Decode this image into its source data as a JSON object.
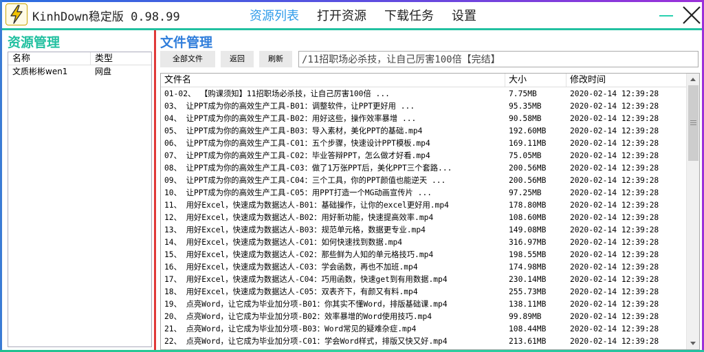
{
  "app": {
    "title": "KinhDown稳定版 0.98.99",
    "logo_icon": "lightning-bolt-icon",
    "accent_color": "#2f9bea",
    "teal_color": "#22c0a0",
    "divider_color": "#e03838"
  },
  "nav": {
    "items": [
      {
        "label": "资源列表",
        "active": true
      },
      {
        "label": "打开资源",
        "active": false
      },
      {
        "label": "下载任务",
        "active": false
      },
      {
        "label": "设置",
        "active": false
      }
    ]
  },
  "window_controls": {
    "minimize_icon": "minimize-icon",
    "close_icon": "close-icon"
  },
  "resource_panel": {
    "title": "资源管理",
    "columns": [
      "名称",
      "类型"
    ],
    "rows": [
      {
        "name": "文质彬彬wen1",
        "type": "网盘"
      }
    ]
  },
  "file_panel": {
    "title": "文件管理",
    "toolbar": {
      "all_files": "全部文件",
      "back": "返回",
      "refresh": "刷新"
    },
    "path": "/11招职场必杀技，让自己厉害100倍【完结】",
    "columns": [
      "文件名",
      "大小",
      "修改时间"
    ],
    "rows": [
      {
        "name": "01-02、 【购课须知】11招职场必杀技，让自己厉害100倍                    ...",
        "size": "7.75MB",
        "time": "2020-02-14 12:39:28"
      },
      {
        "name": "03、  让PPT成为你的高效生产工具-B01：调整软件，让PPT更好用                ...",
        "size": "95.35MB",
        "time": "2020-02-14 12:39:28"
      },
      {
        "name": "04、  让PPT成为你的高效生产工具-B02：用好这些，操作效率暴增                ...",
        "size": "90.58MB",
        "time": "2020-02-14 12:39:28"
      },
      {
        "name": "05、  让PPT成为你的高效生产工具-B03：导入素材，美化PPT的基础.mp4",
        "size": "192.60MB",
        "time": "2020-02-14 12:39:28"
      },
      {
        "name": "06、  让PPT成为你的高效生产工具-C01：五个步骤，快速设计PPT模板.mp4",
        "size": "169.11MB",
        "time": "2020-02-14 12:39:28"
      },
      {
        "name": "07、  让PPT成为你的高效生产工具-C02：毕业答辩PPT，怎么做才好看.mp4",
        "size": "75.05MB",
        "time": "2020-02-14 12:39:28"
      },
      {
        "name": "08、  让PPT成为你的高效生产工具-C03：做了1万张PPT后，美化PPT三个套路...",
        "size": "200.56MB",
        "time": "2020-02-14 12:39:28"
      },
      {
        "name": "09、  让PPT成为你的高效生产工具-C04：三个工具，你的PPT颜值也能逆天    ...",
        "size": "200.56MB",
        "time": "2020-02-14 12:39:28"
      },
      {
        "name": "10、  让PPT成为你的高效生产工具-C05：用PPT打造一个MG动画宣传片       ...",
        "size": "97.25MB",
        "time": "2020-02-14 12:39:28"
      },
      {
        "name": "11、  用好Excel，快速成为数据达人-B01：基础操作，让你的excel更好用.mp4",
        "size": "178.80MB",
        "time": "2020-02-14 12:39:28"
      },
      {
        "name": "12、  用好Excel，快速成为数据达人-B02：用好新功能，快速提高效率.mp4",
        "size": "108.60MB",
        "time": "2020-02-14 12:39:28"
      },
      {
        "name": "13、  用好Excel，快速成为数据达人-B03：规范单元格，数据更专业.mp4",
        "size": "149.08MB",
        "time": "2020-02-14 12:39:28"
      },
      {
        "name": "14、  用好Excel，快速成为数据达人-C01：如何快速找到数据.mp4",
        "size": "316.97MB",
        "time": "2020-02-14 12:39:28"
      },
      {
        "name": "15、  用好Excel，快速成为数据达人-C02：那些鲜为人知的单元格技巧.mp4",
        "size": "198.55MB",
        "time": "2020-02-14 12:39:28"
      },
      {
        "name": "16、  用好Excel，快速成为数据达人-C03：学会函数，再也不加班.mp4",
        "size": "174.98MB",
        "time": "2020-02-14 12:39:28"
      },
      {
        "name": "17、  用好Excel，快速成为数据达人-C04：巧用函数，快速get到有用数据.mp4",
        "size": "230.14MB",
        "time": "2020-02-14 12:39:28"
      },
      {
        "name": "18、  用好Excel，快速成为数据达人-C05：双表齐下，有颜又有料.mp4",
        "size": "255.73MB",
        "time": "2020-02-14 12:39:28"
      },
      {
        "name": "19、  点亮Word，让它成为毕业加分项-B01：你其实不懂Word，排版基础课.mp4",
        "size": "138.11MB",
        "time": "2020-02-14 12:39:28"
      },
      {
        "name": "20、  点亮Word，让它成为毕业加分项-B02：效率暴增的Word使用技巧.mp4",
        "size": "99.89MB",
        "time": "2020-02-14 12:39:28"
      },
      {
        "name": "21、  点亮Word，让它成为毕业加分项-B03：Word常见的疑难杂症.mp4",
        "size": "108.44MB",
        "time": "2020-02-14 12:39:28"
      },
      {
        "name": "22、  点亮Word，让它成为毕业加分项-C01：学会Word样式，排版又快又好.mp4",
        "size": "213.61MB",
        "time": "2020-02-14 12:39:28"
      }
    ]
  }
}
